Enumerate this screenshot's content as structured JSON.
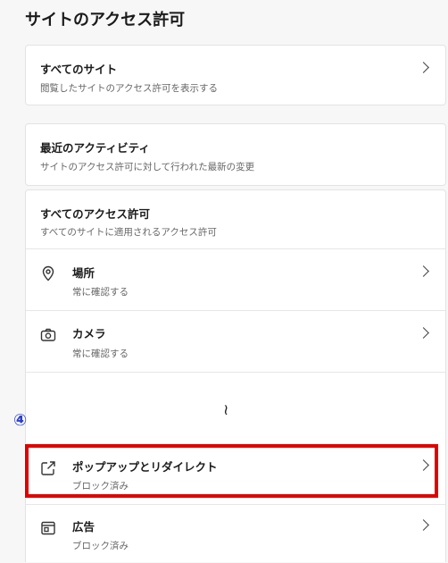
{
  "page": {
    "title": "サイトのアクセス許可"
  },
  "all_sites": {
    "title": "すべてのサイト",
    "subtitle": "閲覧したサイトのアクセス許可を表示する"
  },
  "recent_activity": {
    "title": "最近のアクティビティ",
    "subtitle": "サイトのアクセス許可に対して行われた最新の変更"
  },
  "all_permissions": {
    "title": "すべてのアクセス許可",
    "subtitle": "すべてのサイトに適用されるアクセス許可",
    "items": [
      {
        "label": "場所",
        "status": "常に確認する",
        "icon": "location-pin-icon"
      },
      {
        "label": "カメラ",
        "status": "常に確認する",
        "icon": "camera-icon"
      },
      {
        "label": "ポップアップとリダイレクト",
        "status": "ブロック済み",
        "icon": "external-link-icon"
      },
      {
        "label": "広告",
        "status": "ブロック済み",
        "icon": "ad-window-icon"
      }
    ]
  },
  "annotation": {
    "step": "④",
    "gap_mark": "≀"
  },
  "colors": {
    "highlight": "#e00000",
    "step_marker": "#2a3fd1"
  }
}
